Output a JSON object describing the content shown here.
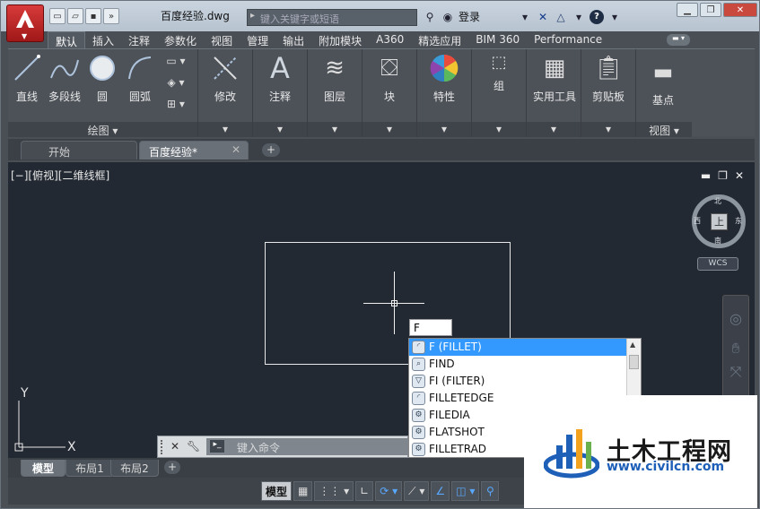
{
  "titlebar": {
    "doc_title": "百度经验.dwg",
    "search_placeholder": "键入关键字或短语",
    "login_label": "登录",
    "help_label": "?"
  },
  "ribbon_tabs": [
    "默认",
    "插入",
    "注释",
    "参数化",
    "视图",
    "管理",
    "输出",
    "附加模块",
    "A360",
    "精选应用",
    "BIM 360",
    "Performance"
  ],
  "ribbon": {
    "draw": {
      "line": "直线",
      "polyline": "多段线",
      "circle": "圆",
      "arc": "圆弧",
      "footer": "绘图 ▾"
    },
    "modify": "修改",
    "annotation": "注释",
    "layers": "图层",
    "block": "块",
    "properties": "特性",
    "groups": "组",
    "utilities": "实用工具",
    "clipboard": "剪贴板",
    "view": {
      "base": "基点",
      "footer": "视图 ▾"
    }
  },
  "file_tabs": {
    "start": "开始",
    "drawing": "百度经验*"
  },
  "viewport": {
    "label": "[−][俯视][二维线框]",
    "viewcube": {
      "north": "北",
      "south": "南",
      "east": "东",
      "west": "西",
      "face": "上"
    },
    "wcs": "WCS",
    "ucs": {
      "x": "X",
      "y": "Y"
    }
  },
  "command": {
    "typed": "F",
    "placeholder": "键入命令",
    "suggestions": [
      "F (FILLET)",
      "FIND",
      "FI (FILTER)",
      "FILLETEDGE",
      "FILEDIA",
      "FLATSHOT",
      "FILLETRAD"
    ],
    "selected_index": 0
  },
  "layout_tabs": [
    "模型",
    "布局1",
    "布局2"
  ],
  "statusbar": {
    "model": "模型"
  },
  "watermark": {
    "title": "土木工程网",
    "url": "www.civilcn.com"
  }
}
